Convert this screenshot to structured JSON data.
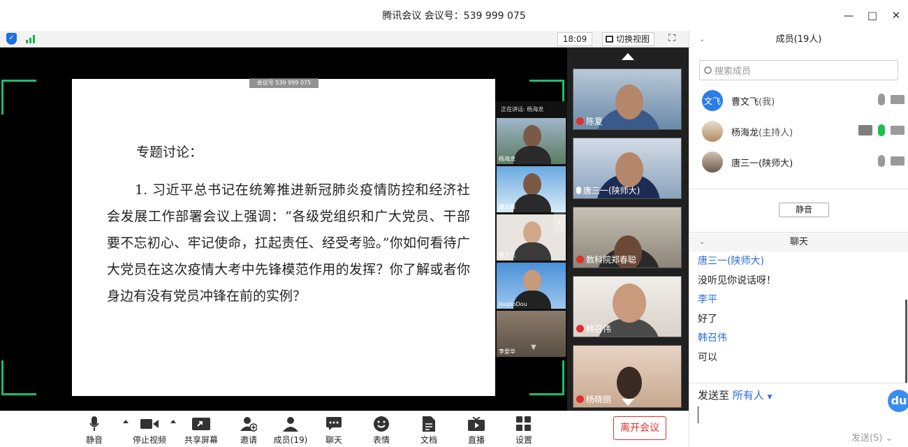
{
  "window": {
    "title": "腾讯会议 会议号：539 999 075",
    "controls": [
      "minimize-icon",
      "maximize-icon",
      "close-icon"
    ]
  },
  "video_header": {
    "clock": "18:09",
    "switch_view": "切换视图"
  },
  "slide": {
    "meeting_tag": "会议号 539 999 075",
    "topic": "专题讨论：",
    "paragraph": "1. 习近平总书记在统筹推进新冠肺炎疫情防控和经济社会发展工作部署会议上强调：“各级党组织和广大党员、干部要不忘初心、牢记使命，扛起责任、经受考验。”你如何看待广大党员在这次疫情大考中先锋模范作用的发挥？你了解或者你身边有没有党员冲锋在前的实例？"
  },
  "strip": {
    "header": "正在讲话: 杨海龙",
    "thumbs": [
      "杨海龙",
      "曹云峰",
      "曹文飞",
      "JiaqboDou",
      "李爱华"
    ]
  },
  "tiles": [
    "陈夏",
    "唐三一(陕师大)",
    "数科院郑春聪",
    "韩召伟",
    "杨晓丽"
  ],
  "toolbar": {
    "mute": "静音",
    "stop_video": "停止视频",
    "share_screen": "共享屏幕",
    "invite": "邀请",
    "members": "成员(19)",
    "chat": "聊天",
    "emoji": "表情",
    "docs": "文档",
    "live": "直播",
    "settings": "设置",
    "leave": "离开会议"
  },
  "members_panel": {
    "title": "成员(19人)",
    "search_placeholder": "搜索成员",
    "members": [
      {
        "avatar": "文飞",
        "name": "曹文飞",
        "role": "(我)",
        "color": "#2b7de9"
      },
      {
        "avatar": "",
        "name": "杨海龙",
        "role": "(主持人)",
        "color": "#c9a57d"
      },
      {
        "avatar": "",
        "name": "唐三一(陕师大)",
        "role": "",
        "color": "#7c6a5b"
      }
    ],
    "mute_all": "静音"
  },
  "chat_panel": {
    "title": "聊天",
    "messages": [
      {
        "name": "唐三一(陕师大)",
        "text": "没听见你说话呀！"
      },
      {
        "name": "李平",
        "text": "好了"
      },
      {
        "name": "韩召伟",
        "text": "可以"
      }
    ],
    "send_to_label": "发送至",
    "send_to_target": "所有人",
    "send_button": "发送(S)"
  }
}
